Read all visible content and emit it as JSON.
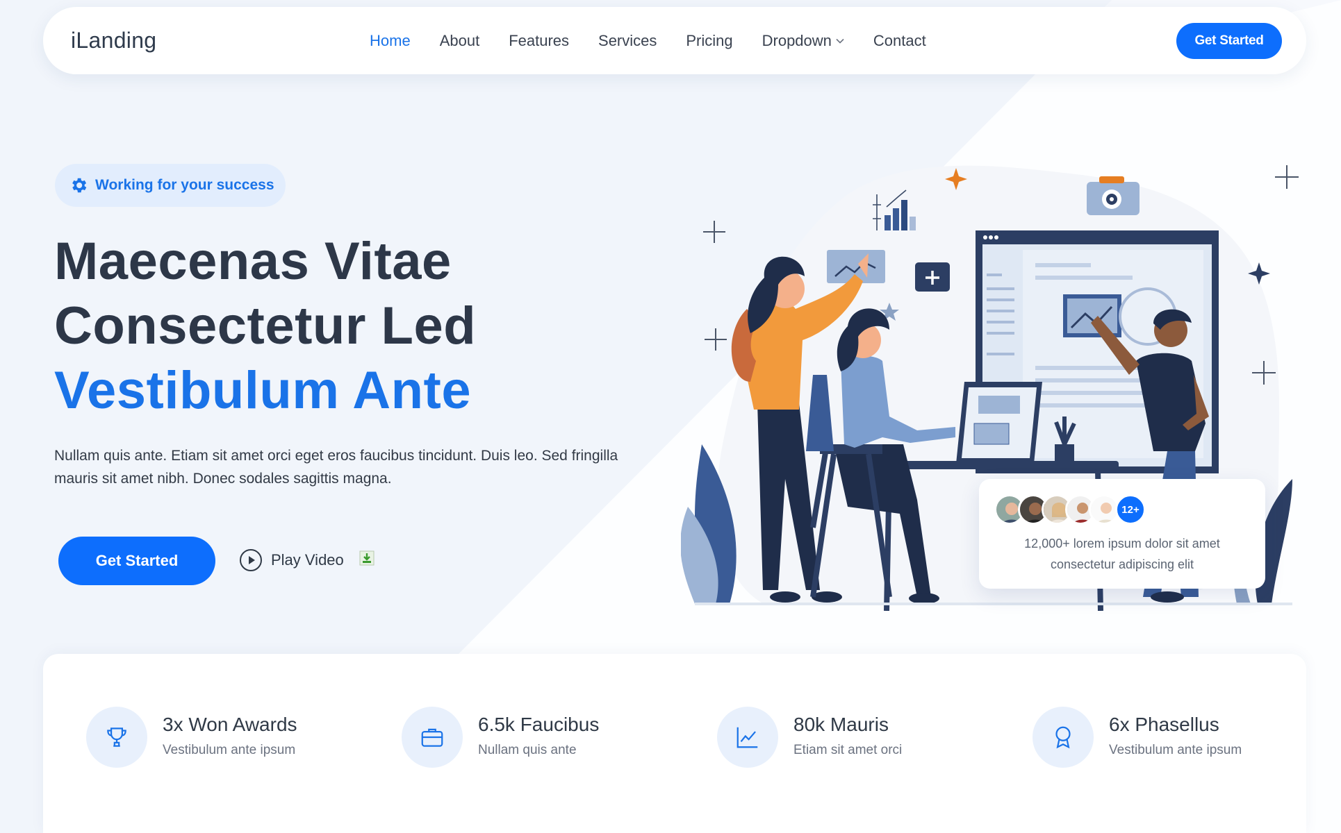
{
  "brand": {
    "logo": "iLanding",
    "accent": "#1a73e8",
    "button": "#0d6efd"
  },
  "nav": {
    "items": [
      {
        "label": "Home",
        "active": true
      },
      {
        "label": "About"
      },
      {
        "label": "Features"
      },
      {
        "label": "Services"
      },
      {
        "label": "Pricing"
      },
      {
        "label": "Dropdown",
        "has_dropdown": true
      },
      {
        "label": "Contact"
      }
    ],
    "cta": "Get Started"
  },
  "hero": {
    "badge": {
      "icon": "gear-icon",
      "text": "Working for your success"
    },
    "headline": [
      "Maecenas Vitae",
      "Consectetur Led",
      "Vestibulum Ante"
    ],
    "lead": "Nullam quis ante. Etiam sit amet orci eget eros faucibus tincidunt. Duis leo. Sed fringilla mauris sit amet nibh. Donec sodales sagittis magna.",
    "primary_button": "Get Started",
    "video_button": {
      "icon": "play-circle-icon",
      "label": "Play Video"
    }
  },
  "social_proof": {
    "count_badge": "12+",
    "text": "12,000+ lorem ipsum dolor sit amet consectetur adipiscing elit"
  },
  "stats": [
    {
      "icon": "trophy-icon",
      "title": "3x Won Awards",
      "subtitle": "Vestibulum ante ipsum"
    },
    {
      "icon": "briefcase-icon",
      "title": "6.5k Faucibus",
      "subtitle": "Nullam quis ante"
    },
    {
      "icon": "graph-up-icon",
      "title": "80k Mauris",
      "subtitle": "Etiam sit amet orci"
    },
    {
      "icon": "award-icon",
      "title": "6x Phasellus",
      "subtitle": "Vestibulum ante ipsum"
    }
  ]
}
